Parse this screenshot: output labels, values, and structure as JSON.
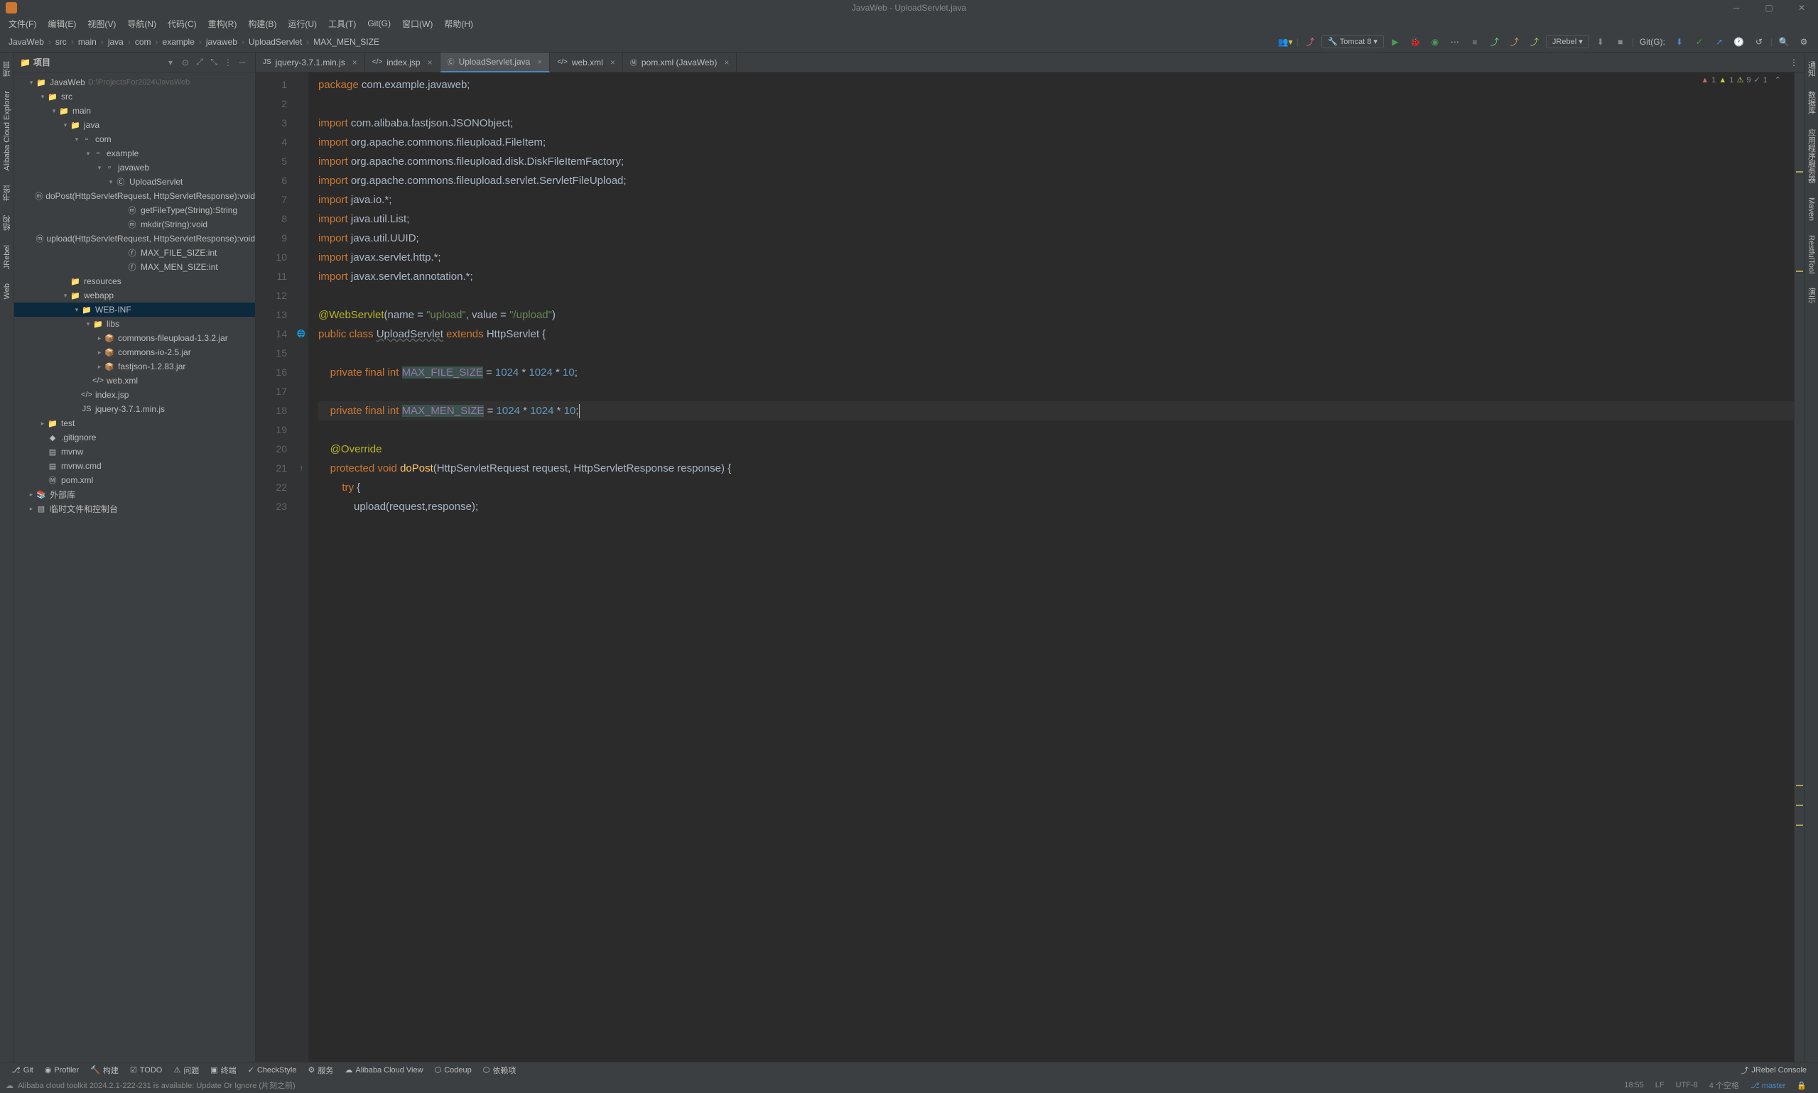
{
  "window": {
    "title": "JavaWeb - UploadServlet.java"
  },
  "menus": [
    "文件(F)",
    "编辑(E)",
    "视图(V)",
    "导航(N)",
    "代码(C)",
    "重构(R)",
    "构建(B)",
    "运行(U)",
    "工具(T)",
    "Git(G)",
    "窗口(W)",
    "帮助(H)"
  ],
  "breadcrumbs": [
    "JavaWeb",
    "src",
    "main",
    "java",
    "com",
    "example",
    "javaweb",
    "UploadServlet",
    "MAX_MEN_SIZE"
  ],
  "run_config": "Tomcat 8",
  "jrebel_label": "JRebel",
  "git_label": "Git(G):",
  "project_panel": {
    "title": "项目",
    "root": {
      "label": "JavaWeb",
      "path": "D:\\ProjectsFor2024\\JavaWeb"
    },
    "tree": [
      {
        "depth": 0,
        "arrow": "▾",
        "label": "JavaWeb",
        "path": "D:\\ProjectsFor2024\\JavaWeb",
        "icon": "folder-root"
      },
      {
        "depth": 1,
        "arrow": "▾",
        "label": "src",
        "icon": "folder-src"
      },
      {
        "depth": 2,
        "arrow": "▾",
        "label": "main",
        "icon": "folder"
      },
      {
        "depth": 3,
        "arrow": "▾",
        "label": "java",
        "icon": "folder-java"
      },
      {
        "depth": 4,
        "arrow": "▾",
        "label": "com",
        "icon": "package"
      },
      {
        "depth": 5,
        "arrow": "▾",
        "label": "example",
        "icon": "package"
      },
      {
        "depth": 6,
        "arrow": "▾",
        "label": "javaweb",
        "icon": "package"
      },
      {
        "depth": 7,
        "arrow": "▾",
        "label": "UploadServlet",
        "icon": "class"
      },
      {
        "depth": 8,
        "arrow": "",
        "label": "doPost(HttpServletRequest, HttpServletResponse):void",
        "icon": "method"
      },
      {
        "depth": 8,
        "arrow": "",
        "label": "getFileType(String):String",
        "icon": "method"
      },
      {
        "depth": 8,
        "arrow": "",
        "label": "mkdir(String):void",
        "icon": "method"
      },
      {
        "depth": 8,
        "arrow": "",
        "label": "upload(HttpServletRequest, HttpServletResponse):void",
        "icon": "method"
      },
      {
        "depth": 8,
        "arrow": "",
        "label": "MAX_FILE_SIZE:int",
        "icon": "field"
      },
      {
        "depth": 8,
        "arrow": "",
        "label": "MAX_MEN_SIZE:int",
        "icon": "field"
      },
      {
        "depth": 3,
        "arrow": "",
        "label": "resources",
        "icon": "folder-res"
      },
      {
        "depth": 3,
        "arrow": "▾",
        "label": "webapp",
        "icon": "folder-web"
      },
      {
        "depth": 4,
        "arrow": "▾",
        "label": "WEB-INF",
        "icon": "folder",
        "selected": true
      },
      {
        "depth": 5,
        "arrow": "▾",
        "label": "libs",
        "icon": "folder"
      },
      {
        "depth": 6,
        "arrow": "▸",
        "label": "commons-fileupload-1.3.2.jar",
        "icon": "jar"
      },
      {
        "depth": 6,
        "arrow": "▸",
        "label": "commons-io-2.5.jar",
        "icon": "jar"
      },
      {
        "depth": 6,
        "arrow": "▸",
        "label": "fastjson-1.2.83.jar",
        "icon": "jar"
      },
      {
        "depth": 5,
        "arrow": "",
        "label": "web.xml",
        "icon": "xml"
      },
      {
        "depth": 4,
        "arrow": "",
        "label": "index.jsp",
        "icon": "jsp"
      },
      {
        "depth": 4,
        "arrow": "",
        "label": "jquery-3.7.1.min.js",
        "icon": "js"
      },
      {
        "depth": 1,
        "arrow": "▸",
        "label": "test",
        "icon": "folder-test"
      },
      {
        "depth": 1,
        "arrow": "",
        "label": ".gitignore",
        "icon": "git"
      },
      {
        "depth": 1,
        "arrow": "",
        "label": "mvnw",
        "icon": "file"
      },
      {
        "depth": 1,
        "arrow": "",
        "label": "mvnw.cmd",
        "icon": "file"
      },
      {
        "depth": 1,
        "arrow": "",
        "label": "pom.xml",
        "icon": "maven"
      },
      {
        "depth": 0,
        "arrow": "▸",
        "label": "外部库",
        "icon": "lib"
      },
      {
        "depth": 0,
        "arrow": "▸",
        "label": "临时文件和控制台",
        "icon": "scratch"
      }
    ]
  },
  "tabs": [
    {
      "label": "jquery-3.7.1.min.js",
      "icon": "js",
      "active": false
    },
    {
      "label": "index.jsp",
      "icon": "jsp",
      "active": false
    },
    {
      "label": "UploadServlet.java",
      "icon": "class",
      "active": true
    },
    {
      "label": "web.xml",
      "icon": "xml",
      "active": false
    },
    {
      "label": "pom.xml (JavaWeb)",
      "icon": "maven",
      "active": false
    }
  ],
  "inspection": {
    "error": "1",
    "warn_a": "1",
    "warn_y": "9",
    "hint": "1"
  },
  "line_numbers": [
    "1",
    "2",
    "3",
    "4",
    "5",
    "6",
    "7",
    "8",
    "9",
    "10",
    "11",
    "12",
    "13",
    "14",
    "15",
    "16",
    "17",
    "18",
    "19",
    "20",
    "21",
    "22",
    "23"
  ],
  "bottom_buttons": [
    "Git",
    "Profiler",
    "构建",
    "TODO",
    "问题",
    "终端",
    "CheckStyle",
    "服务",
    "Alibaba Cloud View",
    "Codeup",
    "依赖项"
  ],
  "bottom_right": "JRebel Console",
  "status": {
    "left": "Alibaba cloud toolkit 2024.2.1-222-231 is available: Update Or Ignore (片刻之前)",
    "pos": "18:55",
    "sep": "LF",
    "enc": "UTF-8",
    "indent": "4 个空格",
    "branch": "master"
  },
  "left_tabs": [
    "项目",
    "Alibaba Cloud Explorer",
    "书签",
    "结构",
    "JRebel",
    "Web"
  ],
  "right_tabs": [
    "通知",
    "数据库",
    "应用程序服务器",
    "Maven",
    "RestfulTool",
    "演示"
  ]
}
